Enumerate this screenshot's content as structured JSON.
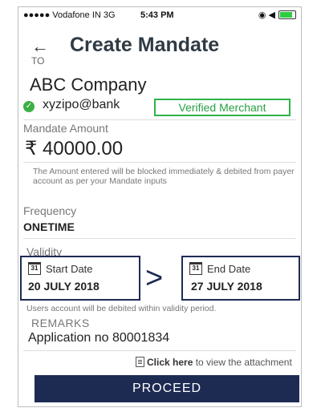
{
  "status_bar": {
    "carrier": "●●●●● Vodafone IN  3G",
    "time": "5:43 PM",
    "icons": "◉ ◀"
  },
  "header": {
    "back_icon": "←",
    "title": "Create Mandate"
  },
  "to": {
    "label": "TO",
    "payee_name": "ABC Company",
    "vpa": "xyzipo@bank",
    "verified_badge": "Verified Merchant"
  },
  "amount": {
    "label": "Mandate Amount",
    "value": "₹ 40000.00",
    "note": "The Amount entered will be blocked immediately & debited from payer account as per your Mandate inputs"
  },
  "frequency": {
    "label": "Frequency",
    "value": "ONETIME"
  },
  "validity": {
    "label": "Validity",
    "start_label": "Start Date",
    "start_value": "20 JULY 2018",
    "end_label": "End Date",
    "end_value": "27 JULY 2018",
    "calendar_day": "31",
    "arrow": ">",
    "note": "Users account will be debited within validity period."
  },
  "remarks": {
    "label": "REMARKS",
    "value": "Application no 80001834"
  },
  "attachment": {
    "link_text": "Click here",
    "suffix": " to view the attachment"
  },
  "proceed_label": "PROCEED",
  "colors": {
    "primary": "#1d2b53",
    "verified": "#2db34a"
  }
}
